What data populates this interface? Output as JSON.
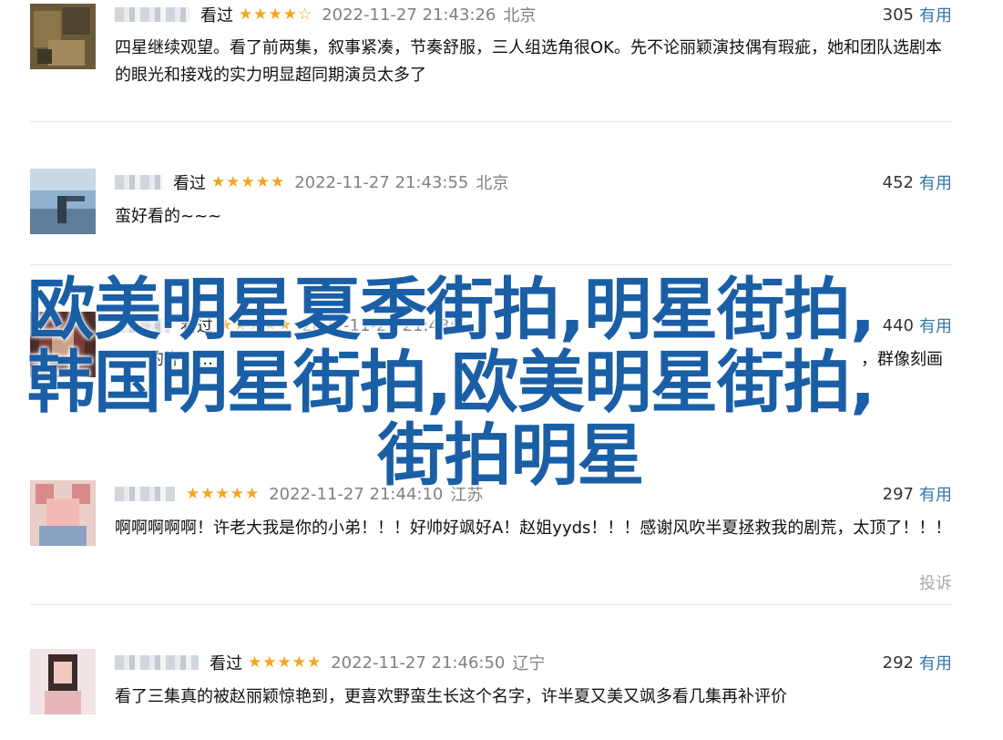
{
  "reviews": [
    {
      "watched_label": "看过",
      "rating": 4,
      "stars": "★★★★☆",
      "time": "2022-11-27 21:43:26",
      "location": "北京",
      "useful_count": "305",
      "useful_label": "有用",
      "text": "四星继续观望。看了前两集，叙事紧凑，节奏舒服，三人组选角很OK。先不论丽颖演技偶有瑕疵，她和团队选剧本的眼光和接戏的实力明显超同期演员太多了"
    },
    {
      "watched_label": "看过",
      "rating": 5,
      "stars": "★★★★★",
      "time": "2022-11-27 21:43:55",
      "location": "北京",
      "useful_count": "452",
      "useful_label": "有用",
      "text": "蛮好看的~~~"
    },
    {
      "watched_label": "看过",
      "rating": 5,
      "stars": "★★★★★",
      "time": "2022-11-27 21:43:",
      "location": "",
      "useful_count": "440",
      "useful_label": "有用",
      "text": "……的许……"
    },
    {
      "watched_label": "",
      "rating": 5,
      "stars": "★★★★★",
      "time": "2022-11-27 21:44:10",
      "location": "江苏",
      "useful_count": "297",
      "useful_label": "有用",
      "text": "啊啊啊啊啊！许老大我是你的小弟！！！好帅好飒好A！赵姐yyds！！！感谢风吹半夏拯救我的剧荒，太顶了！！！",
      "report_label": "投诉"
    },
    {
      "watched_label": "看过",
      "rating": 5,
      "stars": "★★★★★",
      "time": "2022-11-27 21:46:50",
      "location": "辽宁",
      "useful_count": "292",
      "useful_label": "有用",
      "text": "看了三集真的被赵丽颖惊艳到，更喜欢野蛮生长这个名字，许半夏又美又飒多看几集再补评价"
    }
  ],
  "review3_text_right": "，群像刻画",
  "overlay": {
    "line1": "欧美明星夏季街拍,明星街拍,",
    "line2": "韩国明星街拍,欧美明星街拍,",
    "line3": "街拍明星"
  },
  "colors": {
    "star": "#f4a51c",
    "link": "#3377aa",
    "overlay_text": "#1a5fa6",
    "meta_gray": "#808080"
  }
}
